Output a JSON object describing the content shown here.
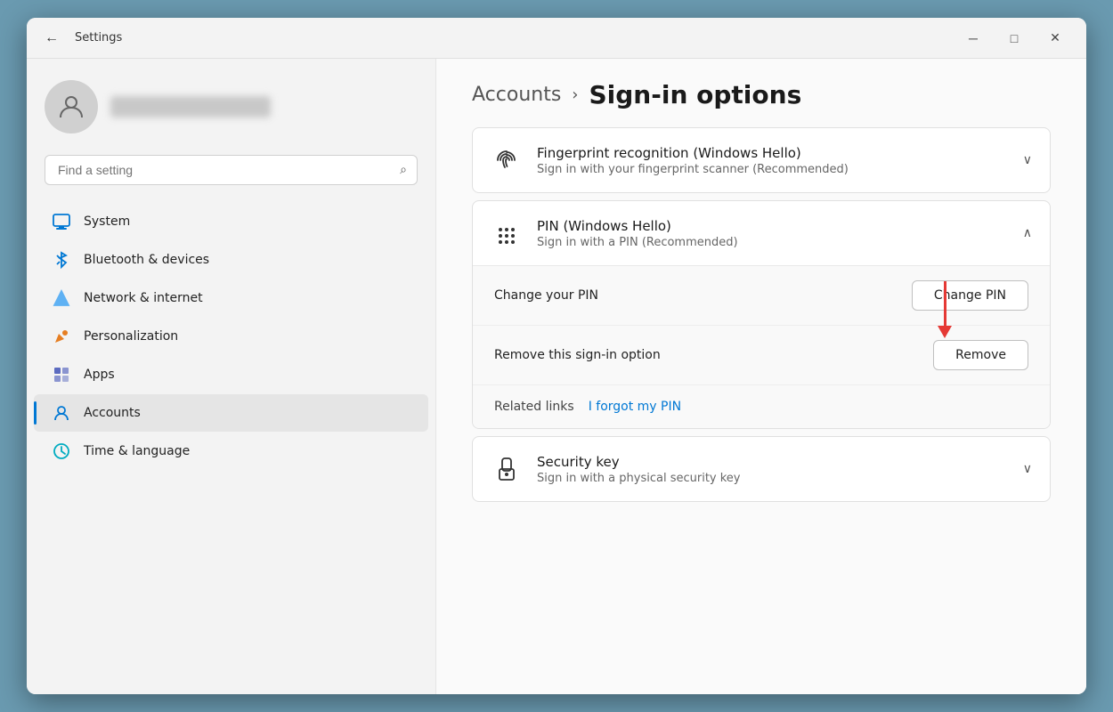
{
  "window": {
    "title": "Settings",
    "back_label": "←",
    "minimize": "─",
    "maximize": "□",
    "close": "✕"
  },
  "sidebar": {
    "search_placeholder": "Find a setting",
    "search_icon": "🔍",
    "nav_items": [
      {
        "id": "system",
        "label": "System",
        "icon": "💻",
        "active": false
      },
      {
        "id": "bluetooth",
        "label": "Bluetooth & devices",
        "icon": "🔵",
        "active": false
      },
      {
        "id": "network",
        "label": "Network & internet",
        "icon": "💎",
        "active": false
      },
      {
        "id": "personalization",
        "label": "Personalization",
        "icon": "✏️",
        "active": false
      },
      {
        "id": "apps",
        "label": "Apps",
        "icon": "📦",
        "active": false
      },
      {
        "id": "accounts",
        "label": "Accounts",
        "icon": "👤",
        "active": true
      },
      {
        "id": "time",
        "label": "Time & language",
        "icon": "🌐",
        "active": false
      }
    ]
  },
  "main": {
    "breadcrumb": "Accounts",
    "breadcrumb_arrow": "›",
    "page_title": "Sign-in options",
    "sections": [
      {
        "id": "fingerprint",
        "icon": "🔍",
        "title": "Fingerprint recognition (Windows Hello)",
        "subtitle": "Sign in with your fingerprint scanner (Recommended)",
        "expanded": false,
        "chevron": "∨"
      },
      {
        "id": "pin",
        "icon": "⠿",
        "title": "PIN (Windows Hello)",
        "subtitle": "Sign in with a PIN (Recommended)",
        "expanded": true,
        "chevron": "∧",
        "rows": [
          {
            "label": "Change your PIN",
            "button": "Change PIN"
          },
          {
            "label": "Remove this sign-in option",
            "button": "Remove"
          }
        ],
        "related_label": "Related links",
        "related_link": "I forgot my PIN"
      },
      {
        "id": "security-key",
        "icon": "🔒",
        "title": "Security key",
        "subtitle": "Sign in with a physical security key",
        "expanded": false,
        "chevron": "∨"
      }
    ]
  }
}
